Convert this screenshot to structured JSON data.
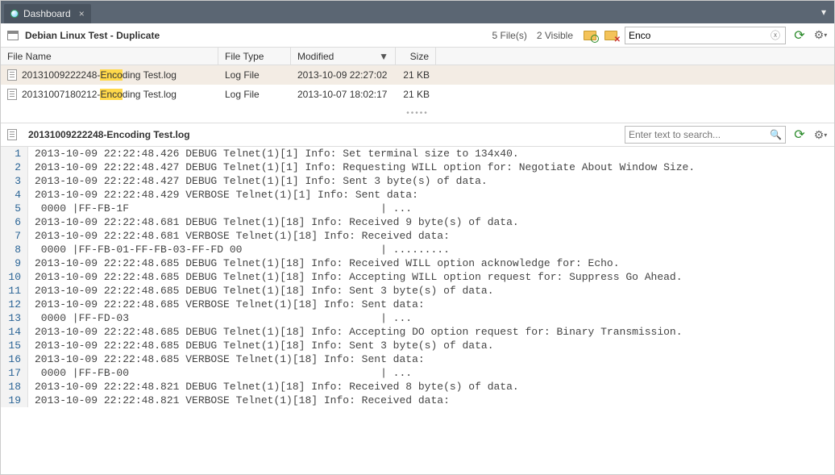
{
  "tab": {
    "label": "Dashboard"
  },
  "panel": {
    "title": "Debian Linux Test - Duplicate",
    "file_count": "5 File(s)",
    "visible_count": "2 Visible",
    "filter_value": "Enco"
  },
  "columns": {
    "name": "File Name",
    "type": "File Type",
    "modified": "Modified",
    "size": "Size"
  },
  "files": [
    {
      "name_pre": "20131009222248-",
      "name_hl": "Enco",
      "name_post": "ding Test.log",
      "type": "Log File",
      "modified": "2013-10-09 22:27:02",
      "size": "21 KB",
      "selected": true
    },
    {
      "name_pre": "20131007180212-",
      "name_hl": "Enco",
      "name_post": "ding Test.log",
      "type": "Log File",
      "modified": "2013-10-07 18:02:17",
      "size": "21 KB",
      "selected": false
    }
  ],
  "detail": {
    "title": "20131009222248-Encoding Test.log",
    "search_placeholder": "Enter text to search..."
  },
  "log_lines": [
    "2013-10-09 22:22:48.426 DEBUG Telnet(1)[1] Info: Set terminal size to 134x40.",
    "2013-10-09 22:22:48.427 DEBUG Telnet(1)[1] Info: Requesting WILL option for: Negotiate About Window Size.",
    "2013-10-09 22:22:48.427 DEBUG Telnet(1)[1] Info: Sent 3 byte(s) of data.",
    "2013-10-09 22:22:48.429 VERBOSE Telnet(1)[1] Info: Sent data:",
    " 0000 |FF-FB-1F                                        | ...",
    "2013-10-09 22:22:48.681 DEBUG Telnet(1)[18] Info: Received 9 byte(s) of data.",
    "2013-10-09 22:22:48.681 VERBOSE Telnet(1)[18] Info: Received data:",
    " 0000 |FF-FB-01-FF-FB-03-FF-FD 00                      | .........",
    "2013-10-09 22:22:48.685 DEBUG Telnet(1)[18] Info: Received WILL option acknowledge for: Echo.",
    "2013-10-09 22:22:48.685 DEBUG Telnet(1)[18] Info: Accepting WILL option request for: Suppress Go Ahead.",
    "2013-10-09 22:22:48.685 DEBUG Telnet(1)[18] Info: Sent 3 byte(s) of data.",
    "2013-10-09 22:22:48.685 VERBOSE Telnet(1)[18] Info: Sent data:",
    " 0000 |FF-FD-03                                        | ...",
    "2013-10-09 22:22:48.685 DEBUG Telnet(1)[18] Info: Accepting DO option request for: Binary Transmission.",
    "2013-10-09 22:22:48.685 DEBUG Telnet(1)[18] Info: Sent 3 byte(s) of data.",
    "2013-10-09 22:22:48.685 VERBOSE Telnet(1)[18] Info: Sent data:",
    " 0000 |FF-FB-00                                        | ...",
    "2013-10-09 22:22:48.821 DEBUG Telnet(1)[18] Info: Received 8 byte(s) of data.",
    "2013-10-09 22:22:48.821 VERBOSE Telnet(1)[18] Info: Received data:"
  ]
}
